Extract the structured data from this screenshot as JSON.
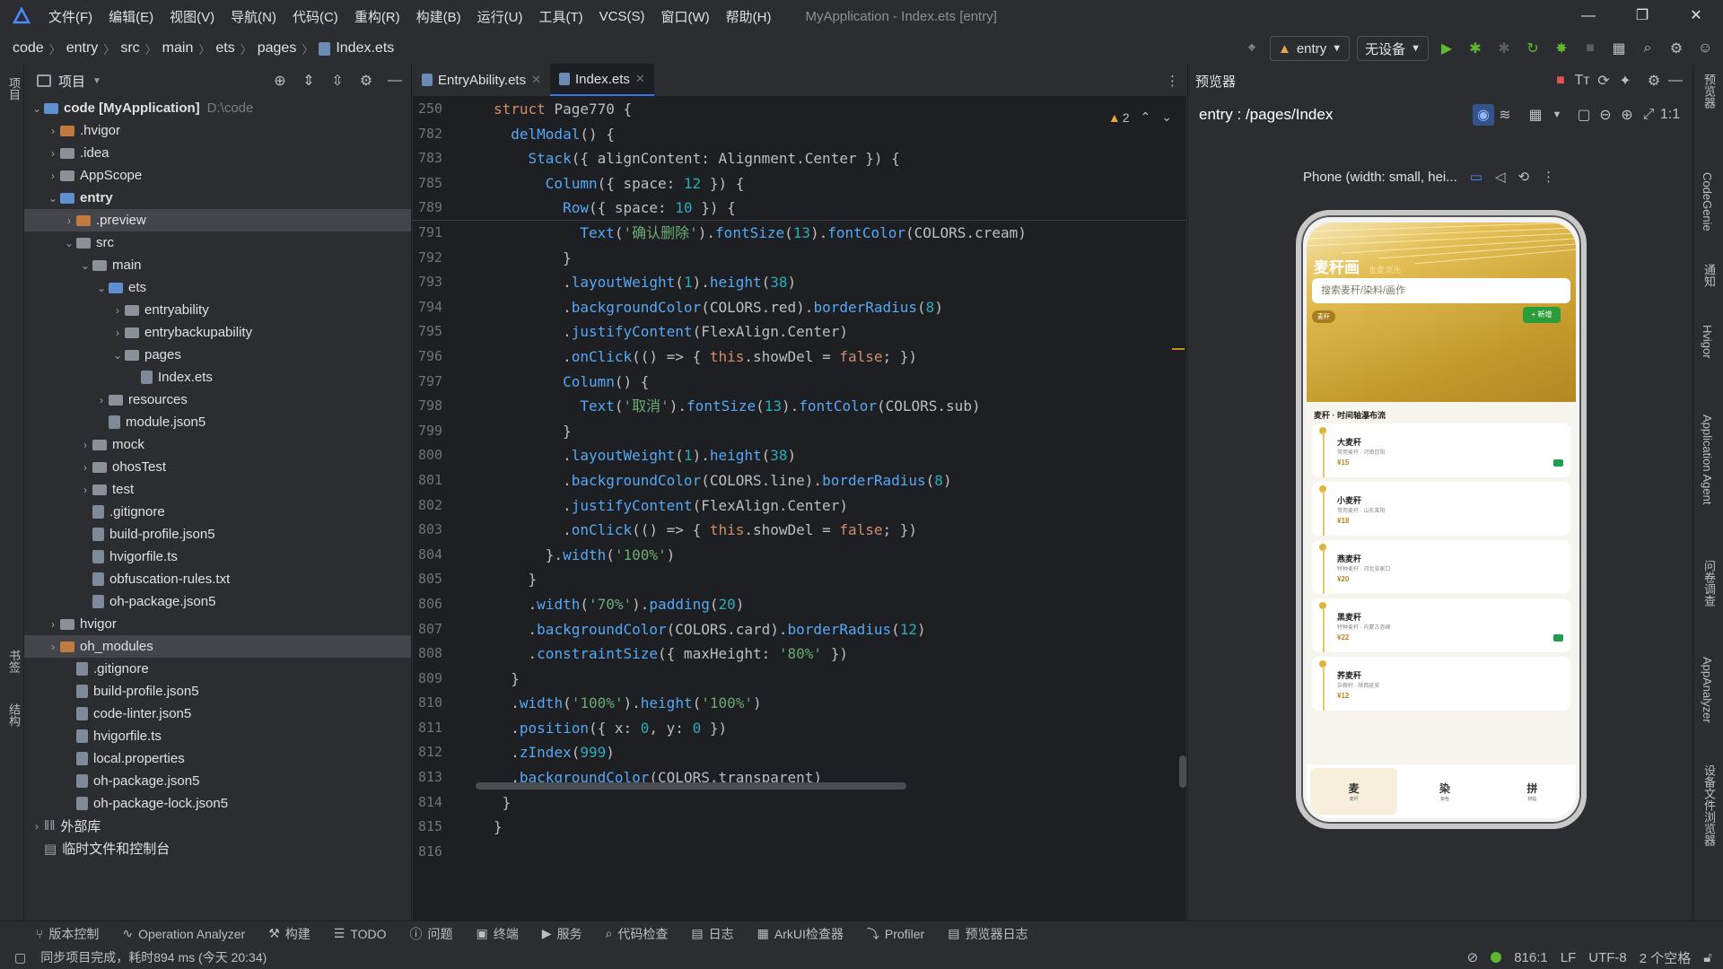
{
  "menubar": {
    "items": [
      "文件(F)",
      "编辑(E)",
      "视图(V)",
      "导航(N)",
      "代码(C)",
      "重构(R)",
      "构建(B)",
      "运行(U)",
      "工具(T)",
      "VCS(S)",
      "窗口(W)",
      "帮助(H)"
    ],
    "window_title": "MyApplication - Index.ets [entry]"
  },
  "breadcrumb": [
    "code",
    "entry",
    "src",
    "main",
    "ets",
    "pages",
    "Index.ets"
  ],
  "toolbar": {
    "run_config": "entry",
    "device": "无设备"
  },
  "project": {
    "title": "项目",
    "tree": [
      {
        "label": "code [MyApplication]",
        "path": "D:\\code",
        "indent": 0,
        "arrow": "down",
        "icon": "folder-blue",
        "bold": true
      },
      {
        "label": ".hvigor",
        "indent": 1,
        "arrow": "right",
        "icon": "folder-orange"
      },
      {
        "label": ".idea",
        "indent": 1,
        "arrow": "right",
        "icon": "folder"
      },
      {
        "label": "AppScope",
        "indent": 1,
        "arrow": "right",
        "icon": "folder"
      },
      {
        "label": "entry",
        "indent": 1,
        "arrow": "down",
        "icon": "folder-blue",
        "bold": true
      },
      {
        "label": ".preview",
        "indent": 2,
        "arrow": "right",
        "icon": "folder-orange",
        "selected": true
      },
      {
        "label": "src",
        "indent": 2,
        "arrow": "down",
        "icon": "folder"
      },
      {
        "label": "main",
        "indent": 3,
        "arrow": "down",
        "icon": "folder"
      },
      {
        "label": "ets",
        "indent": 4,
        "arrow": "down",
        "icon": "folder-blue"
      },
      {
        "label": "entryability",
        "indent": 5,
        "arrow": "right",
        "icon": "folder"
      },
      {
        "label": "entrybackupability",
        "indent": 5,
        "arrow": "right",
        "icon": "folder"
      },
      {
        "label": "pages",
        "indent": 5,
        "arrow": "down",
        "icon": "folder"
      },
      {
        "label": "Index.ets",
        "indent": 6,
        "arrow": "",
        "icon": "file"
      },
      {
        "label": "resources",
        "indent": 4,
        "arrow": "right",
        "icon": "folder"
      },
      {
        "label": "module.json5",
        "indent": 4,
        "arrow": "",
        "icon": "file"
      },
      {
        "label": "mock",
        "indent": 3,
        "arrow": "right",
        "icon": "folder"
      },
      {
        "label": "ohosTest",
        "indent": 3,
        "arrow": "right",
        "icon": "folder"
      },
      {
        "label": "test",
        "indent": 3,
        "arrow": "right",
        "icon": "folder"
      },
      {
        "label": ".gitignore",
        "indent": 3,
        "arrow": "",
        "icon": "file"
      },
      {
        "label": "build-profile.json5",
        "indent": 3,
        "arrow": "",
        "icon": "file"
      },
      {
        "label": "hvigorfile.ts",
        "indent": 3,
        "arrow": "",
        "icon": "file"
      },
      {
        "label": "obfuscation-rules.txt",
        "indent": 3,
        "arrow": "",
        "icon": "file"
      },
      {
        "label": "oh-package.json5",
        "indent": 3,
        "arrow": "",
        "icon": "file"
      },
      {
        "label": "hvigor",
        "indent": 1,
        "arrow": "right",
        "icon": "folder"
      },
      {
        "label": "oh_modules",
        "indent": 1,
        "arrow": "right",
        "icon": "folder-orange",
        "selected": true
      },
      {
        "label": ".gitignore",
        "indent": 2,
        "arrow": "",
        "icon": "file"
      },
      {
        "label": "build-profile.json5",
        "indent": 2,
        "arrow": "",
        "icon": "file"
      },
      {
        "label": "code-linter.json5",
        "indent": 2,
        "arrow": "",
        "icon": "file"
      },
      {
        "label": "hvigorfile.ts",
        "indent": 2,
        "arrow": "",
        "icon": "file"
      },
      {
        "label": "local.properties",
        "indent": 2,
        "arrow": "",
        "icon": "file"
      },
      {
        "label": "oh-package.json5",
        "indent": 2,
        "arrow": "",
        "icon": "file"
      },
      {
        "label": "oh-package-lock.json5",
        "indent": 2,
        "arrow": "",
        "icon": "file"
      },
      {
        "label": "外部库",
        "indent": 0,
        "arrow": "right",
        "icon": "lib"
      },
      {
        "label": "临时文件和控制台",
        "indent": 0,
        "arrow": "",
        "icon": "console"
      }
    ]
  },
  "editor": {
    "tabs": [
      {
        "label": "EntryAbility.ets",
        "active": false
      },
      {
        "label": "Index.ets",
        "active": true
      }
    ],
    "warnings": "2",
    "sticky": [
      {
        "ln": "250",
        "code": [
          [
            "kw",
            "struct "
          ],
          [
            "ty",
            "Page770"
          ],
          [
            "ty",
            " {"
          ]
        ]
      },
      {
        "ln": "782",
        "code": [
          [
            "ty",
            "  "
          ],
          [
            "fn",
            "delModal"
          ],
          [
            "ty",
            "() {"
          ]
        ]
      },
      {
        "ln": "783",
        "code": [
          [
            "ty",
            "    "
          ],
          [
            "fn",
            "Stack"
          ],
          [
            "ty",
            "({ alignContent: Alignment.Center }) {"
          ]
        ]
      },
      {
        "ln": "785",
        "code": [
          [
            "ty",
            "      "
          ],
          [
            "fn",
            "Column"
          ],
          [
            "ty",
            "({ space: "
          ],
          [
            "num",
            "12"
          ],
          [
            "ty",
            " }) {"
          ]
        ]
      },
      {
        "ln": "789",
        "code": [
          [
            "ty",
            "        "
          ],
          [
            "fn",
            "Row"
          ],
          [
            "ty",
            "({ space: "
          ],
          [
            "num",
            "10"
          ],
          [
            "ty",
            " }) {"
          ]
        ]
      }
    ],
    "lines": [
      {
        "ln": "791",
        "code": [
          [
            "ty",
            "          "
          ],
          [
            "fn",
            "Text"
          ],
          [
            "ty",
            "("
          ],
          [
            "str",
            "'确认删除'"
          ],
          [
            "ty",
            ")."
          ],
          [
            "fn",
            "fontSize"
          ],
          [
            "ty",
            "("
          ],
          [
            "num",
            "13"
          ],
          [
            "ty",
            ")."
          ],
          [
            "fn",
            "fontColor"
          ],
          [
            "ty",
            "(COLORS.cream)"
          ]
        ]
      },
      {
        "ln": "792",
        "code": [
          [
            "ty",
            "        }"
          ]
        ]
      },
      {
        "ln": "793",
        "code": [
          [
            "ty",
            "        ."
          ],
          [
            "fn",
            "layoutWeight"
          ],
          [
            "ty",
            "("
          ],
          [
            "num",
            "1"
          ],
          [
            "ty",
            ")."
          ],
          [
            "fn",
            "height"
          ],
          [
            "ty",
            "("
          ],
          [
            "num",
            "38"
          ],
          [
            "ty",
            ")"
          ]
        ]
      },
      {
        "ln": "794",
        "code": [
          [
            "ty",
            "        ."
          ],
          [
            "fn",
            "backgroundColor"
          ],
          [
            "ty",
            "(COLORS.red)."
          ],
          [
            "fn",
            "borderRadius"
          ],
          [
            "ty",
            "("
          ],
          [
            "num",
            "8"
          ],
          [
            "ty",
            ")"
          ]
        ]
      },
      {
        "ln": "795",
        "code": [
          [
            "ty",
            "        ."
          ],
          [
            "fn",
            "justifyContent"
          ],
          [
            "ty",
            "(FlexAlign.Center)"
          ]
        ]
      },
      {
        "ln": "796",
        "code": [
          [
            "ty",
            "        ."
          ],
          [
            "fn",
            "onClick"
          ],
          [
            "ty",
            "(() => { "
          ],
          [
            "kw",
            "this"
          ],
          [
            "ty",
            ".showDel = "
          ],
          [
            "kw",
            "false"
          ],
          [
            "ty",
            "; })"
          ]
        ]
      },
      {
        "ln": "797",
        "code": [
          [
            "ty",
            "        "
          ],
          [
            "fn",
            "Column"
          ],
          [
            "ty",
            "() {"
          ]
        ]
      },
      {
        "ln": "798",
        "code": [
          [
            "ty",
            "          "
          ],
          [
            "fn",
            "Text"
          ],
          [
            "ty",
            "("
          ],
          [
            "str",
            "'取消'"
          ],
          [
            "ty",
            ")."
          ],
          [
            "fn",
            "fontSize"
          ],
          [
            "ty",
            "("
          ],
          [
            "num",
            "13"
          ],
          [
            "ty",
            ")."
          ],
          [
            "fn",
            "fontColor"
          ],
          [
            "ty",
            "(COLORS.sub)"
          ]
        ]
      },
      {
        "ln": "799",
        "code": [
          [
            "ty",
            "        }"
          ]
        ]
      },
      {
        "ln": "800",
        "code": [
          [
            "ty",
            "        ."
          ],
          [
            "fn",
            "layoutWeight"
          ],
          [
            "ty",
            "("
          ],
          [
            "num",
            "1"
          ],
          [
            "ty",
            ")."
          ],
          [
            "fn",
            "height"
          ],
          [
            "ty",
            "("
          ],
          [
            "num",
            "38"
          ],
          [
            "ty",
            ")"
          ]
        ]
      },
      {
        "ln": "801",
        "code": [
          [
            "ty",
            "        ."
          ],
          [
            "fn",
            "backgroundColor"
          ],
          [
            "ty",
            "(COLORS.line)."
          ],
          [
            "fn",
            "borderRadius"
          ],
          [
            "ty",
            "("
          ],
          [
            "num",
            "8"
          ],
          [
            "ty",
            ")"
          ]
        ]
      },
      {
        "ln": "802",
        "code": [
          [
            "ty",
            "        ."
          ],
          [
            "fn",
            "justifyContent"
          ],
          [
            "ty",
            "(FlexAlign.Center)"
          ]
        ]
      },
      {
        "ln": "803",
        "code": [
          [
            "ty",
            "        ."
          ],
          [
            "fn",
            "onClick"
          ],
          [
            "ty",
            "(() => { "
          ],
          [
            "kw",
            "this"
          ],
          [
            "ty",
            ".showDel = "
          ],
          [
            "kw",
            "false"
          ],
          [
            "ty",
            "; })"
          ]
        ]
      },
      {
        "ln": "804",
        "code": [
          [
            "ty",
            "      }."
          ],
          [
            "fn",
            "width"
          ],
          [
            "ty",
            "("
          ],
          [
            "str",
            "'100%'"
          ],
          [
            "ty",
            ")"
          ]
        ]
      },
      {
        "ln": "805",
        "code": [
          [
            "ty",
            "    }"
          ]
        ]
      },
      {
        "ln": "806",
        "code": [
          [
            "ty",
            "    ."
          ],
          [
            "fn",
            "width"
          ],
          [
            "ty",
            "("
          ],
          [
            "str",
            "'70%'"
          ],
          [
            "ty",
            ")."
          ],
          [
            "fn",
            "padding"
          ],
          [
            "ty",
            "("
          ],
          [
            "num",
            "20"
          ],
          [
            "ty",
            ")"
          ]
        ]
      },
      {
        "ln": "807",
        "code": [
          [
            "ty",
            "    ."
          ],
          [
            "fn",
            "backgroundColor"
          ],
          [
            "ty",
            "(COLORS.card)."
          ],
          [
            "fn",
            "borderRadius"
          ],
          [
            "ty",
            "("
          ],
          [
            "num",
            "12"
          ],
          [
            "ty",
            ")"
          ]
        ]
      },
      {
        "ln": "808",
        "code": [
          [
            "ty",
            "    ."
          ],
          [
            "fn",
            "constraintSize"
          ],
          [
            "ty",
            "({ maxHeight: "
          ],
          [
            "str",
            "'80%'"
          ],
          [
            "ty",
            " })"
          ]
        ]
      },
      {
        "ln": "809",
        "code": [
          [
            "ty",
            "  }"
          ]
        ]
      },
      {
        "ln": "810",
        "code": [
          [
            "ty",
            "  ."
          ],
          [
            "fn",
            "width"
          ],
          [
            "ty",
            "("
          ],
          [
            "str",
            "'100%'"
          ],
          [
            "ty",
            ")."
          ],
          [
            "fn",
            "height"
          ],
          [
            "ty",
            "("
          ],
          [
            "str",
            "'100%'"
          ],
          [
            "ty",
            ")"
          ]
        ]
      },
      {
        "ln": "811",
        "code": [
          [
            "ty",
            "  ."
          ],
          [
            "fn",
            "position"
          ],
          [
            "ty",
            "({ x: "
          ],
          [
            "num",
            "0"
          ],
          [
            "ty",
            ", y: "
          ],
          [
            "num",
            "0"
          ],
          [
            "ty",
            " })"
          ]
        ]
      },
      {
        "ln": "812",
        "code": [
          [
            "ty",
            "  ."
          ],
          [
            "fn",
            "zIndex"
          ],
          [
            "ty",
            "("
          ],
          [
            "num",
            "999"
          ],
          [
            "ty",
            ")"
          ]
        ]
      },
      {
        "ln": "813",
        "code": [
          [
            "ty",
            "  ."
          ],
          [
            "fn",
            "backgroundColor"
          ],
          [
            "ty",
            "(COLORS.transparent)"
          ]
        ]
      },
      {
        "ln": "814",
        "code": [
          [
            "ty",
            " }"
          ]
        ]
      },
      {
        "ln": "815",
        "code": [
          [
            "ty",
            "}"
          ]
        ]
      },
      {
        "ln": "816",
        "code": [
          [
            "ty",
            ""
          ]
        ]
      }
    ]
  },
  "preview": {
    "title": "预览器",
    "route": "entry : /pages/Index",
    "device_label": "Phone (width: small, hei...",
    "app": {
      "title": "麦秆画",
      "subtitle": "金麦流光",
      "search_placeholder": "搜索麦秆/染料/画作",
      "chip": "麦秆",
      "add_button": "+ 新增",
      "section": "麦秆 · 时间轴瀑布流",
      "cards": [
        {
          "name": "大麦秆",
          "desc": "常用麦秆 · 河南信阳",
          "price": "¥15",
          "tag": true
        },
        {
          "name": "小麦秆",
          "desc": "常用麦秆 · 山东莱阳",
          "price": "¥18",
          "tag": false
        },
        {
          "name": "燕麦秆",
          "desc": "特种麦秆 · 河北张家口",
          "price": "¥20",
          "tag": false
        },
        {
          "name": "黑麦秆",
          "desc": "特种麦秆 · 内蒙古赤峰",
          "price": "¥22",
          "tag": true
        },
        {
          "name": "荞麦秆",
          "desc": "杂粮秆 · 陕西延安",
          "price": "¥12",
          "tag": false
        }
      ],
      "tabs": [
        {
          "icon": "麦",
          "label": "麦秆"
        },
        {
          "icon": "染",
          "label": "染色"
        },
        {
          "icon": "拼",
          "label": "拼贴"
        }
      ]
    }
  },
  "left_strip": {
    "project": "项目",
    "bookmarks": "书签",
    "structure": "结构"
  },
  "right_strip": [
    "预览器",
    "CodeGenie",
    "通知",
    "Hvigor",
    "Application Agent",
    "问卷调查",
    "AppAnalyzer",
    "设备文件浏览器"
  ],
  "bottom_tools": [
    "版本控制",
    "Operation Analyzer",
    "构建",
    "TODO",
    "问题",
    "终端",
    "服务",
    "代码检查",
    "日志",
    "ArkUI检查器",
    "Profiler",
    "预览器日志"
  ],
  "status": {
    "message": "同步项目完成，耗时894 ms (今天 20:34)",
    "position": "816:1",
    "line_sep": "LF",
    "encoding": "UTF-8",
    "indent": "2 个空格"
  },
  "colors": {
    "accent": "#3574f0",
    "hero_gold": "#c49a2c",
    "card_tag": "#1f9d55",
    "add_btn": "#2a9d3a"
  }
}
